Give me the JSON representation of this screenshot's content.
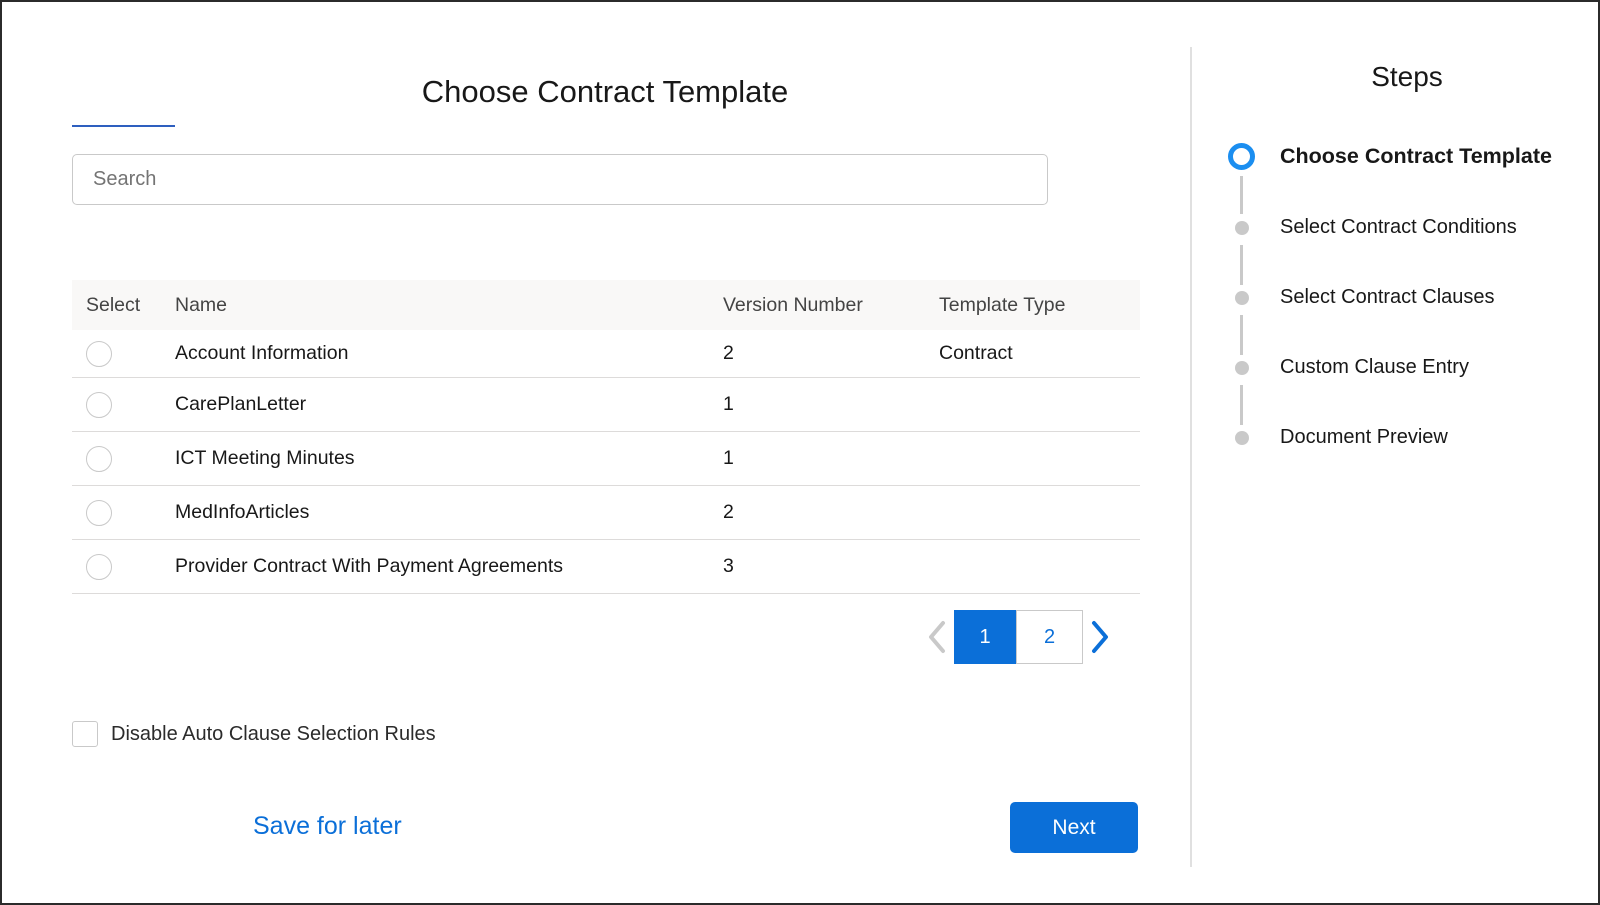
{
  "page": {
    "title": "Choose Contract Template"
  },
  "search": {
    "placeholder": "Search",
    "value": ""
  },
  "table": {
    "columns": [
      "Select",
      "Name",
      "Version Number",
      "Template Type"
    ],
    "rows": [
      {
        "name": "Account Information",
        "version": "2",
        "type": "Contract",
        "selected": false
      },
      {
        "name": "CarePlanLetter",
        "version": "1",
        "type": "",
        "selected": false
      },
      {
        "name": "ICT Meeting Minutes",
        "version": "1",
        "type": "",
        "selected": false
      },
      {
        "name": "MedInfoArticles",
        "version": "2",
        "type": "",
        "selected": false
      },
      {
        "name": "Provider Contract With Payment Agreements",
        "version": "3",
        "type": "",
        "selected": false
      }
    ]
  },
  "pagination": {
    "prev_icon": "chevron-left-icon",
    "next_icon": "chevron-right-icon",
    "pages": [
      "1",
      "2"
    ],
    "current_page": "1"
  },
  "options": {
    "disable_auto_clause_label": "Disable Auto Clause Selection Rules",
    "disable_auto_clause_checked": false
  },
  "footer": {
    "save_for_later_label": "Save for later",
    "next_label": "Next"
  },
  "steps": {
    "title": "Steps",
    "items": [
      {
        "label": "Choose Contract Template",
        "active": true
      },
      {
        "label": "Select Contract Conditions",
        "active": false
      },
      {
        "label": "Select Contract Clauses",
        "active": false
      },
      {
        "label": "Custom Clause Entry",
        "active": false
      },
      {
        "label": "Document Preview",
        "active": false
      }
    ]
  },
  "colors": {
    "brand_blue": "#0b6fd8",
    "active_step": "#1b8ef0",
    "inactive_step": "#c9c9c9",
    "title_underline": "#2e5fbf"
  }
}
